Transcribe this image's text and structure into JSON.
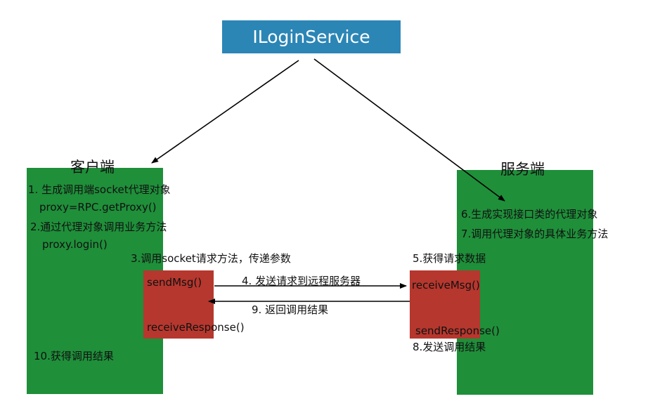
{
  "service": {
    "title": "ILoginService"
  },
  "client": {
    "heading": "客户端",
    "step1": "1.  生成调用端socket代理对象",
    "step1_code": "proxy=RPC.getProxy()",
    "step2": "2.通过代理对象调用业务方法",
    "step2_code": "proxy.login()",
    "step3": "3.调用socket请求方法，传递参数",
    "send_method": "sendMsg()",
    "receive_method": "receiveResponse()",
    "step10": "10.获得调用结果"
  },
  "server": {
    "heading": "服务端",
    "step6": "6.生成实现接口类的代理对象",
    "step7": "7.调用代理对象的具体业务方法",
    "step5": "5.获得请求数据",
    "receive_method": "receiveMsg()",
    "send_method": "sendResponse()",
    "step8": "8.发送调用结果"
  },
  "arrows": {
    "step4": "4. 发送请求到远程服务器",
    "step9": "9. 返回调用结果"
  },
  "colors": {
    "service_box": "#2b86b6",
    "panel_green": "#1f8f3a",
    "method_box_red": "#b6372e"
  }
}
